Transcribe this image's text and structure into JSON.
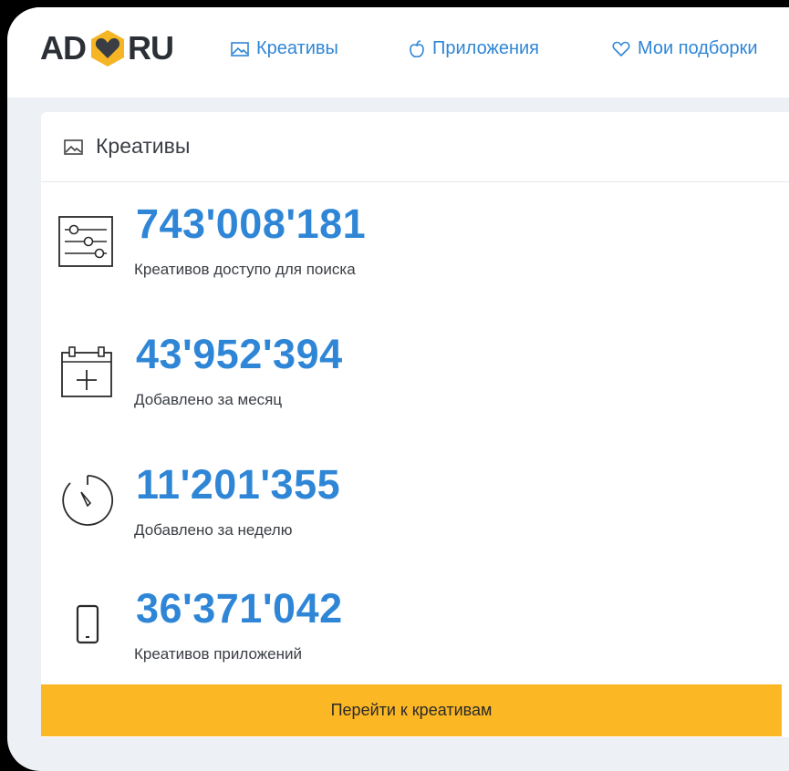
{
  "header": {
    "logo_left": "AD",
    "logo_right": "RU",
    "nav": [
      {
        "label": "Креативы",
        "icon": "image-icon"
      },
      {
        "label": "Приложения",
        "icon": "apple-icon"
      },
      {
        "label": "Мои подборки",
        "icon": "heart-icon"
      }
    ]
  },
  "card": {
    "title": "Креативы",
    "stats": [
      {
        "value": "743'008'181",
        "label": "Креативов доступо для поиска",
        "icon": "sliders-icon"
      },
      {
        "value": "43'952'394",
        "label": "Добавлено за месяц",
        "icon": "calendar-plus-icon"
      },
      {
        "value": "11'201'355",
        "label": "Добавлено за неделю",
        "icon": "timer-icon"
      },
      {
        "value": "36'371'042",
        "label": "Креативов приложений",
        "icon": "phone-icon"
      }
    ],
    "cta_label": "Перейти к креативам"
  },
  "colors": {
    "accent": "#2f86d6",
    "cta": "#fbb724",
    "background": "#edf0f4"
  }
}
